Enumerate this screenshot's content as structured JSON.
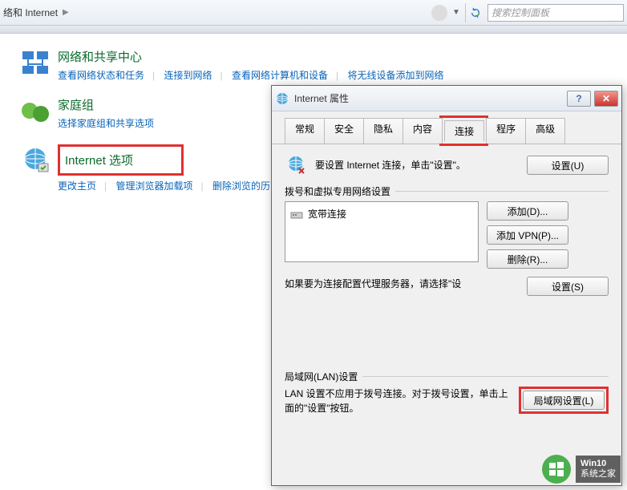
{
  "addr": {
    "crumb": "络和 Internet"
  },
  "search": {
    "placeholder": "搜索控制面板"
  },
  "categories": {
    "network": {
      "title": "网络和共享中心",
      "links": [
        "查看网络状态和任务",
        "连接到网络",
        "查看网络计算机和设备",
        "将无线设备添加到网络"
      ]
    },
    "home": {
      "title": "家庭组",
      "links": [
        "选择家庭组和共享选项"
      ]
    },
    "ie": {
      "title": "Internet 选项",
      "links": [
        "更改主页",
        "管理浏览器加载项",
        "删除浏览的历"
      ]
    }
  },
  "dialog": {
    "title": "Internet 属性",
    "tabs": [
      "常规",
      "安全",
      "隐私",
      "内容",
      "连接",
      "程序",
      "高级"
    ],
    "active_tab": 4,
    "info_text": "要设置 Internet 连接，单击\"设置\"。",
    "setup_btn": "设置(U)",
    "dialup_label": "拨号和虚拟专用网络设置",
    "conn_item": "宽带连接",
    "add_btn": "添加(D)...",
    "add_vpn_btn": "添加 VPN(P)...",
    "remove_btn": "删除(R)...",
    "proxy_text": "如果要为连接配置代理服务器，请选择\"设",
    "settings_btn": "设置(S)",
    "lan_label": "局域网(LAN)设置",
    "lan_text": "LAN 设置不应用于拨号连接。对于拨号设置，单击上面的\"设置\"按钮。",
    "lan_btn": "局域网设置(L)"
  },
  "watermark": {
    "l1": "Win10",
    "l2": "系统之家"
  }
}
